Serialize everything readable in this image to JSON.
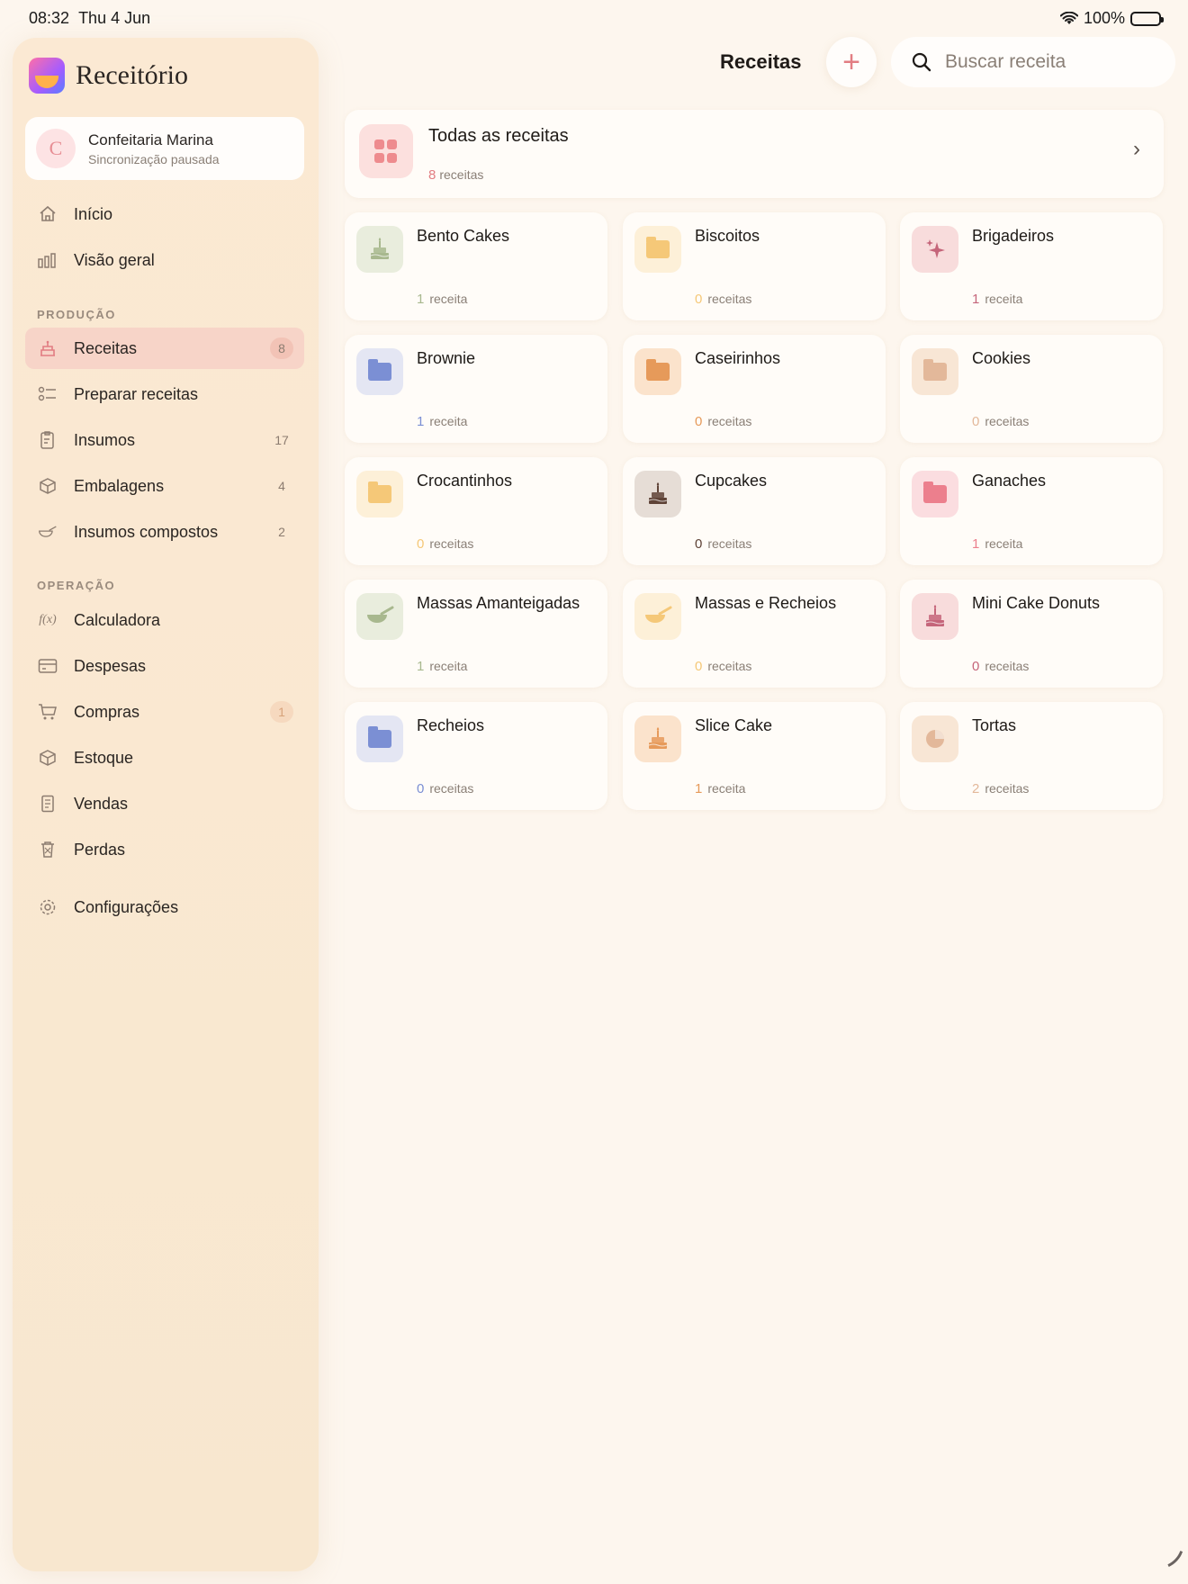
{
  "status": {
    "time": "08:32",
    "date": "Thu 4 Jun",
    "battery": "100%"
  },
  "app": {
    "title": "Receitório"
  },
  "account": {
    "initial": "C",
    "name": "Confeitaria Marina",
    "status": "Sincronização pausada"
  },
  "nav": {
    "inicio": "Início",
    "visao": "Visão geral",
    "section_producao": "PRODUÇÃO",
    "receitas": {
      "label": "Receitas",
      "count": "8"
    },
    "preparar": "Preparar receitas",
    "insumos": {
      "label": "Insumos",
      "count": "17"
    },
    "embalagens": {
      "label": "Embalagens",
      "count": "4"
    },
    "compostos": {
      "label": "Insumos compostos",
      "count": "2"
    },
    "section_operacao": "OPERAÇÃO",
    "calculadora": "Calculadora",
    "calc_icon": "f(x)",
    "despesas": "Despesas",
    "compras": {
      "label": "Compras",
      "count": "1"
    },
    "estoque": "Estoque",
    "vendas": "Vendas",
    "perdas": "Perdas",
    "config": "Configurações"
  },
  "header": {
    "title": "Receitas",
    "add": "+",
    "search_placeholder": "Buscar receita"
  },
  "all": {
    "title": "Todas as receitas",
    "count": "8",
    "unit": "receitas",
    "chevron": "›"
  },
  "categories": [
    {
      "name": "Bento Cakes",
      "count": "1",
      "unit": "receita",
      "icon": "cake-icon",
      "bg": "#e9eddd",
      "color": "#a8b88e"
    },
    {
      "name": "Biscoitos",
      "count": "0",
      "unit": "receitas",
      "icon": "folder-icon",
      "bg": "#fdf0d8",
      "color": "#f5c878"
    },
    {
      "name": "Brigadeiros",
      "count": "1",
      "unit": "receita",
      "icon": "sparkle-icon",
      "bg": "#f8dcdc",
      "color": "#c5657a"
    },
    {
      "name": "Brownie",
      "count": "1",
      "unit": "receita",
      "icon": "folder-icon",
      "bg": "#e4e6f3",
      "color": "#7b8fd4"
    },
    {
      "name": "Caseirinhos",
      "count": "0",
      "unit": "receitas",
      "icon": "folder-icon",
      "bg": "#fbe3cc",
      "color": "#e69a5a"
    },
    {
      "name": "Cookies",
      "count": "0",
      "unit": "receitas",
      "icon": "folder-icon",
      "bg": "#f8e6d5",
      "color": "#e3b89a"
    },
    {
      "name": "Crocantinhos",
      "count": "0",
      "unit": "receitas",
      "icon": "folder-icon",
      "bg": "#fdf0d8",
      "color": "#f5c878"
    },
    {
      "name": "Cupcakes",
      "count": "0",
      "unit": "receitas",
      "icon": "cake-icon",
      "bg": "#e6ddd6",
      "color": "#5f4337"
    },
    {
      "name": "Ganaches",
      "count": "1",
      "unit": "receita",
      "icon": "folder-icon",
      "bg": "#fbdde0",
      "color": "#ec7f8d"
    },
    {
      "name": "Massas Amanteigadas",
      "count": "1",
      "unit": "receita",
      "icon": "bowl-icon",
      "bg": "#e9eddd",
      "color": "#a8b88e"
    },
    {
      "name": "Massas e Recheios",
      "count": "0",
      "unit": "receitas",
      "icon": "bowl-icon",
      "bg": "#fdf0d8",
      "color": "#f5c878"
    },
    {
      "name": "Mini Cake Donuts",
      "count": "0",
      "unit": "receitas",
      "icon": "cake-icon",
      "bg": "#f8dcdc",
      "color": "#c5657a"
    },
    {
      "name": "Recheios",
      "count": "0",
      "unit": "receitas",
      "icon": "folder-icon",
      "bg": "#e4e6f3",
      "color": "#7b8fd4"
    },
    {
      "name": "Slice Cake",
      "count": "1",
      "unit": "receita",
      "icon": "cake-icon",
      "bg": "#fbe3cc",
      "color": "#e69a5a"
    },
    {
      "name": "Tortas",
      "count": "2",
      "unit": "receitas",
      "icon": "pie-icon",
      "bg": "#f8e6d5",
      "color": "#e3b89a"
    }
  ]
}
